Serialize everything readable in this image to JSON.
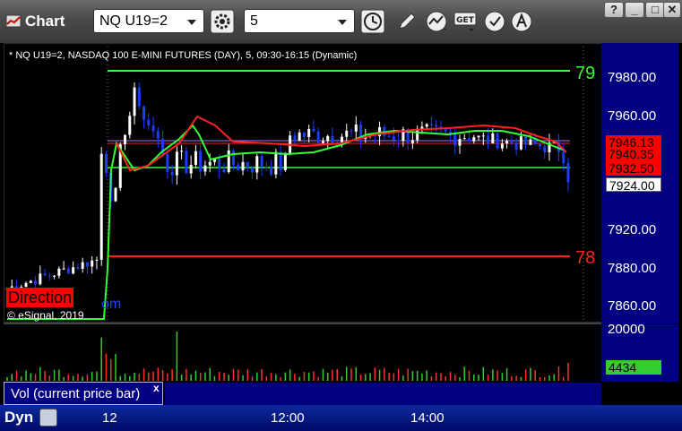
{
  "window": {
    "title": "Chart",
    "symbol_value": "NQ U19=2",
    "interval_value": "5",
    "help_btn": "?",
    "min_btn": "_",
    "max_btn": "□",
    "close_btn": "✕",
    "tools": [
      "clock-icon",
      "pencil-icon",
      "study-icon",
      "get-icon",
      "tools-icon",
      "cursor-icon"
    ]
  },
  "chart": {
    "label": "* NQ U19=2, NASDAQ 100 E-MINI FUTURES (DAY), 5, 09:30-16:15 (Dynamic)",
    "y_ticks": [
      "7980.00",
      "7960.00",
      "7940.00",
      "7920.00",
      "7900.00",
      "7880.00",
      "7860.00"
    ],
    "x_ticks": [
      "12",
      "12:00",
      "14:00"
    ],
    "line_labels": {
      "green_top": "79",
      "red_bottom": "78"
    },
    "price_boxes": [
      {
        "text": "7946.13",
        "bg": "#ff0000",
        "fg": "#000000"
      },
      {
        "text": "7940.35",
        "bg": "#ff0000",
        "fg": "#000000"
      },
      {
        "text": "7932.50",
        "bg": "#ff0000",
        "fg": "#000000"
      },
      {
        "text": "7924.00",
        "bg": "#ffffff",
        "fg": "#000000"
      }
    ],
    "direction_label": "Direction",
    "copyright": "© eSignal, 2019",
    "copyright_suffix": "om"
  },
  "volume": {
    "legend": "Vol (current price bar)",
    "legend_close": "x",
    "axis_tick": "20000",
    "current": "4434",
    "current_bg": "#33cc33"
  },
  "footer": {
    "dyn_label": "Dyn"
  },
  "colors": {
    "up": "#ffffff",
    "down": "#1a3cff",
    "ma_red": "#ff2020",
    "ma_green": "#33ff33"
  }
}
